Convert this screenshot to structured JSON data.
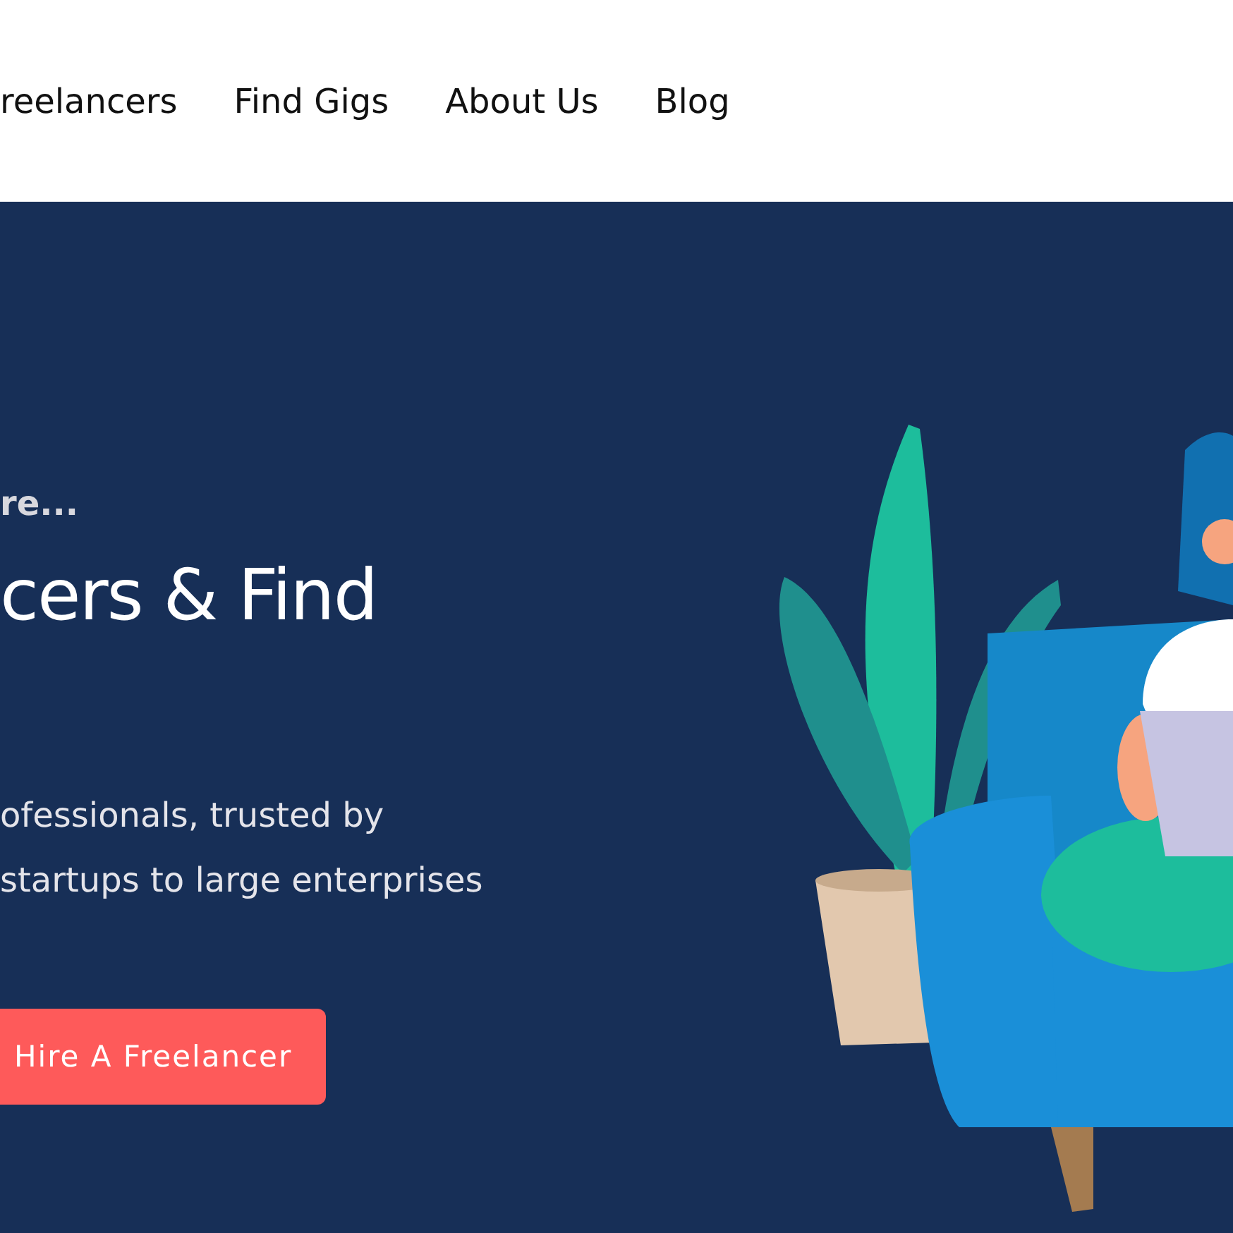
{
  "nav": {
    "links": [
      {
        "label": "reelancers"
      },
      {
        "label": "Find Gigs"
      },
      {
        "label": "About Us"
      },
      {
        "label": "Blog"
      }
    ]
  },
  "hero": {
    "eyebrow": "re...",
    "headline": "cers & Find",
    "description": [
      "ofessionals, trusted by",
      "startups to large enterprises"
    ],
    "button": "Hire A Freelancer"
  }
}
